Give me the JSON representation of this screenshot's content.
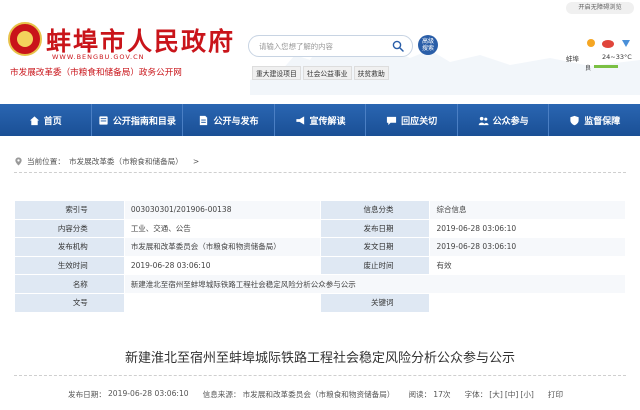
{
  "header": {
    "site_title": "蚌埠市人民政府",
    "domain": "WWW.BENGBU.GOV.CN",
    "sub_title": "市发展改革委（市粮食和储备局）政务公开网",
    "search_placeholder": "请输入您想了解的内容",
    "adv_search_label": "高级\n搜索",
    "hot_links": [
      "重大建设项目",
      "社会公益事业",
      "扶贫救助"
    ],
    "accessible_label": "开启无障碍浏览",
    "weather_city": "蚌埠",
    "weather_temp": "24~33°C",
    "weather_aqi": "良"
  },
  "nav": {
    "items": [
      {
        "label": "首页",
        "icon": "home-icon"
      },
      {
        "label": "公开指南和目录",
        "icon": "book-icon"
      },
      {
        "label": "公开与发布",
        "icon": "document-icon"
      },
      {
        "label": "宣传解读",
        "icon": "megaphone-icon"
      },
      {
        "label": "回应关切",
        "icon": "chat-icon"
      },
      {
        "label": "公众参与",
        "icon": "people-icon"
      },
      {
        "label": "监督保障",
        "icon": "shield-icon"
      }
    ]
  },
  "breadcrumb": {
    "prefix": "当前位置：",
    "path": "市发展改革委（市粮食和储备局）",
    "separator": ">"
  },
  "meta": {
    "rows": [
      [
        {
          "k": "索引号",
          "v": "003030301/201906-00138"
        },
        {
          "k": "信息分类",
          "v": "综合信息"
        }
      ],
      [
        {
          "k": "内容分类",
          "v": "工业、交通、公告"
        },
        {
          "k": "发布日期",
          "v": "2019-06-28 03:06:10"
        }
      ],
      [
        {
          "k": "发布机构",
          "v": "市发展和改革委员会（市粮食和物资储备局）"
        },
        {
          "k": "发文日期",
          "v": "2019-06-28 03:06:10"
        }
      ],
      [
        {
          "k": "生效时间",
          "v": "2019-06-28 03:06:10"
        },
        {
          "k": "废止时间",
          "v": "有效"
        }
      ]
    ],
    "name_label": "名称",
    "name_value": "新建淮北至宿州至蚌埠城际铁路工程社会稳定风险分析公众参与公示",
    "docno_label": "文号",
    "docno_value": "",
    "keywords_label": "关键词",
    "keywords_value": ""
  },
  "article": {
    "title": "新建淮北至宿州至蚌埠城际铁路工程社会稳定风险分析公众参与公示",
    "date_label": "发布日期：",
    "date": "2019-06-28 03:06:10",
    "source_label": "信息来源：",
    "source": "市发展和改革委员会（市粮食和物资储备局）",
    "views_label": "阅读：",
    "views": "17次",
    "font_label": "字体：",
    "font_large": "[大]",
    "font_medium": "[中]",
    "font_small": "[小]",
    "print_label": "打印"
  },
  "colors": {
    "brand_red": "#c9141a",
    "nav_blue": "#1f5aa3",
    "table_key_bg": "#dfe8f3"
  }
}
